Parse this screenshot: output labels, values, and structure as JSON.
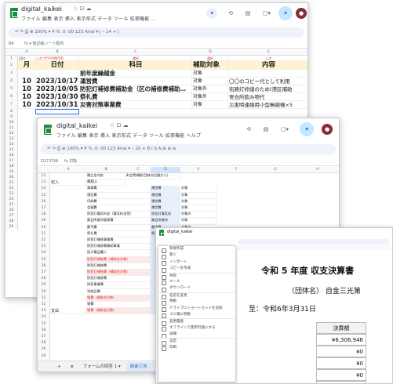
{
  "window1": {
    "doc_title": "digital_kaikei",
    "title_icons": "☆ ⊡ ☁",
    "menu": "ファイル  編集  表示  挿入  表示形式  データ  ツール  拡張機能  …",
    "toolbar": "↶  ↷  ⎙  ⊕  100%  ▾   ¥  %  .0  .00  123   Arial   ▾  |  –  14  +  |",
    "cell_ref": "B4",
    "formula": "fx  ▾ 他記帳シート配布",
    "col_heads": [
      "A",
      "B",
      "C",
      "D",
      "E"
    ],
    "row1": [
      "日付",
      "入力  YYYY/MM/DD",
      "選択",
      "選択",
      "入力"
    ],
    "headers": [
      "月",
      "日付",
      "科目",
      "補助対象",
      "内容"
    ],
    "rows": [
      {
        "n": "3",
        "month": "",
        "date": "",
        "subject": "前年度繰越金",
        "target": "対象",
        "content": ""
      },
      {
        "n": "4",
        "month": "10",
        "date": "2023/10/17",
        "subject": "運営費",
        "target": "対象",
        "content": "〇〇のコピー代として利用"
      },
      {
        "n": "5",
        "month": "10",
        "date": "2023/10/05",
        "subject": "防犯灯補修費補助金（区の補修費補助…",
        "target": "対象外",
        "content": "街路灯修繕のため(港区補助"
      },
      {
        "n": "6",
        "month": "10",
        "date": "2023/10/30",
        "subject": "祭礼費",
        "target": "対象外",
        "content": "寄合所飲み物代"
      },
      {
        "n": "7",
        "month": "10",
        "date": "2023/10/31",
        "subject": "災害対策事業費",
        "target": "対象",
        "content": "災害時連絡用小型無線機×5"
      }
    ],
    "extra_rows": [
      "8",
      "9",
      "10",
      "11",
      "12",
      "13",
      "14",
      "15",
      "16",
      "17",
      "18",
      "19",
      "20",
      "21",
      "22",
      "23",
      "24",
      "25",
      "26",
      "27",
      "28",
      "29"
    ]
  },
  "window2": {
    "doc_title": "digital_kaikei",
    "title_icons": "☆ ⊡ ☁",
    "menu": "ファイル  編集  表示  挿入  表示形式  データ  ツール  拡張機能  ヘルプ",
    "toolbar": "↶  ↷  ⎙  ⊕  100%  ▾   ¥  %  .0  .00  123   Arial   ▾  –  10  +  B  I  S  A  ⊞  ⊟  ≡",
    "cell_ref": "D17:D3A",
    "formula": "fx  対象",
    "col_heads": [
      "A",
      "B",
      "C",
      "D",
      "E",
      "F",
      "G",
      "H"
    ],
    "top": [
      "積立金内訳",
      "町会等補助(団体名記載から)"
    ],
    "section_income": "収入",
    "section_expense": "支出",
    "income_head": "補助入",
    "income_rows": [
      {
        "name": "事業費",
        "tag": "運営費",
        "target": "対象"
      },
      {
        "name": "通信費",
        "tag": "運営費",
        "target": "対象"
      },
      {
        "name": "印刷費",
        "tag": "運営費",
        "target": "対象"
      },
      {
        "name": "会議費",
        "tag": "運営費",
        "target": "対象"
      },
      {
        "name": "防犯灯電気料金（電気料金等）",
        "tag": "防犯灯電気料",
        "target": "対象外"
      },
      {
        "name": "集会所維持管理費",
        "tag": "集会所維持",
        "target": "対象"
      },
      {
        "name": "慶弔費",
        "tag": "慶弔費",
        "target": "対象外"
      },
      {
        "name": "祭礼費",
        "tag": "祭礼費",
        "target": "対象外"
      }
    ],
    "expense_rows": [
      {
        "name": "防犯灯補修事業費",
        "target": "対象",
        "pink": false
      },
      {
        "name": "防犯灯補修費補助事業",
        "target": "対象",
        "pink": false
      },
      {
        "name": "防災備品購入",
        "target": "対象",
        "pink": false
      },
      {
        "name": "防犯灯補修費（補助金対象）",
        "target": "対象外",
        "pink": true
      },
      {
        "name": "防犯灯補修費",
        "target": "対象",
        "pink": false
      },
      {
        "name": "防犯灯補修費（補助金対象）",
        "target": "対象外",
        "pink": true
      },
      {
        "name": "防犯灯補修費",
        "target": "対象",
        "pink": false
      },
      {
        "name": "防犯事業費",
        "target": "対象",
        "pink": false
      },
      {
        "name": "消耗品費",
        "target": "対象",
        "pink": false
      },
      {
        "name": "雑費（補助金対象）",
        "target": "対象外",
        "pink": true
      },
      {
        "name": "雑費",
        "target": "対象",
        "pink": false
      },
      {
        "name": "雑費（補助金対象）",
        "target": "対象外",
        "pink": true
      }
    ],
    "row_numbers": [
      "12",
      "13",
      "14",
      "15",
      "16",
      "17",
      "18",
      "19",
      "20",
      "21",
      "22",
      "23",
      "24",
      "25",
      "26",
      "27",
      "28",
      "29",
      "30",
      "31",
      "32",
      "33",
      "34",
      "35",
      "36",
      "37",
      "38",
      "39",
      "40"
    ],
    "sheet_tabs": [
      "+",
      "≡",
      "フォームの回答 1 ▾",
      "自金三光"
    ]
  },
  "window3": {
    "doc_title": "digital_kaikei",
    "report_title": "令和 5 年度 収支決算書",
    "report_org": "（団体名）  自金三光第",
    "report_period": "至：令和6年3月31日",
    "col_label": "決算額",
    "amounts": [
      "¥6,306,946",
      "¥0",
      "¥0",
      "¥0",
      "¥0"
    ],
    "menu_items": [
      "新規作成",
      "開く",
      "インポート",
      "コピーを作成",
      "共有",
      "メール",
      "ダウンロード",
      "名前を変更",
      "移動",
      "ドライブにショートカットを追加",
      "ゴミ箱に移動",
      "変更履歴",
      "オフラインで使用可能にする",
      "詳細",
      "設定",
      "印刷"
    ]
  }
}
